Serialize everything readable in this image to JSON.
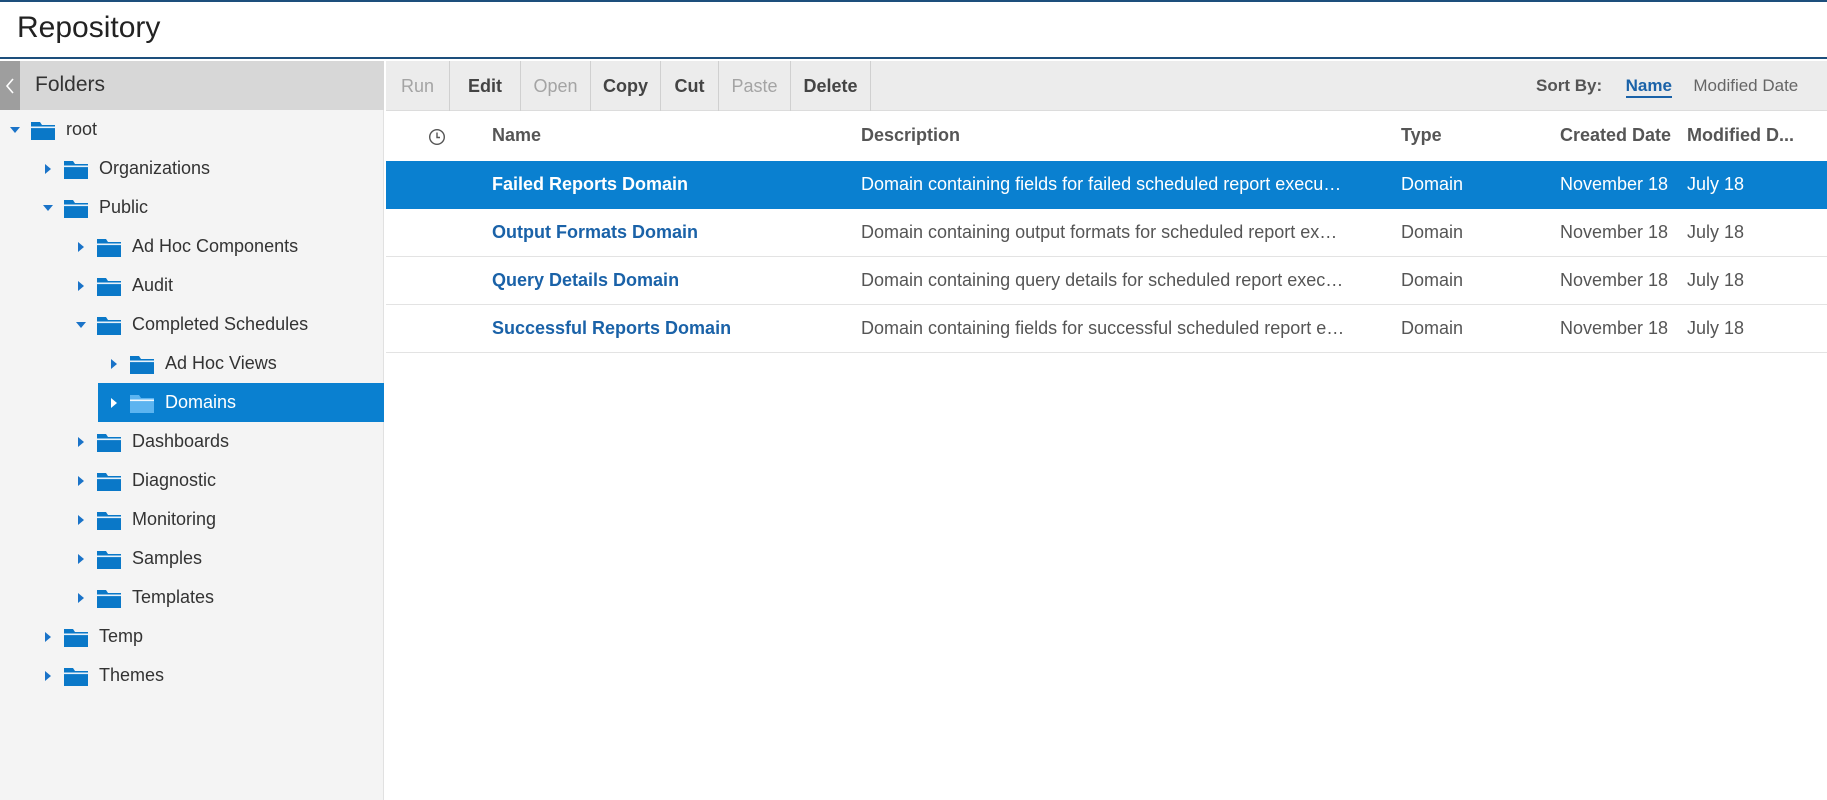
{
  "app": {
    "title": "Repository"
  },
  "folders_panel": {
    "title": "Folders",
    "tree": [
      {
        "label": "root",
        "expanded": true,
        "selected": false
      },
      {
        "label": "Organizations",
        "expanded": false,
        "selected": false
      },
      {
        "label": "Public",
        "expanded": true,
        "selected": false
      },
      {
        "label": "Ad Hoc Components",
        "expanded": false,
        "selected": false
      },
      {
        "label": "Audit",
        "expanded": false,
        "selected": false
      },
      {
        "label": "Completed Schedules",
        "expanded": true,
        "selected": false
      },
      {
        "label": "Ad Hoc Views",
        "expanded": false,
        "selected": false
      },
      {
        "label": "Domains",
        "expanded": false,
        "selected": true
      },
      {
        "label": "Dashboards",
        "expanded": false,
        "selected": false
      },
      {
        "label": "Diagnostic",
        "expanded": false,
        "selected": false
      },
      {
        "label": "Monitoring",
        "expanded": false,
        "selected": false
      },
      {
        "label": "Samples",
        "expanded": false,
        "selected": false
      },
      {
        "label": "Templates",
        "expanded": false,
        "selected": false
      },
      {
        "label": "Temp",
        "expanded": false,
        "selected": false
      },
      {
        "label": "Themes",
        "expanded": false,
        "selected": false
      }
    ]
  },
  "toolbar": {
    "buttons": [
      {
        "label": "Run",
        "enabled": false
      },
      {
        "label": "Edit",
        "enabled": true
      },
      {
        "label": "Open",
        "enabled": false
      },
      {
        "label": "Copy",
        "enabled": true
      },
      {
        "label": "Cut",
        "enabled": true
      },
      {
        "label": "Paste",
        "enabled": false
      },
      {
        "label": "Delete",
        "enabled": true
      }
    ],
    "sort_by_label": "Sort By:",
    "sort_options": [
      "Name",
      "Modified Date"
    ],
    "sort_active": "Name"
  },
  "table": {
    "headers": {
      "name": "Name",
      "description": "Description",
      "type": "Type",
      "created": "Created Date",
      "modified": "Modified D..."
    },
    "rows": [
      {
        "name": "Failed Reports Domain",
        "description": "Domain containing fields for failed scheduled report execu…",
        "type": "Domain",
        "created": "November 18",
        "modified": "July 18",
        "selected": true
      },
      {
        "name": "Output Formats Domain",
        "description": "Domain containing output formats for scheduled report ex…",
        "type": "Domain",
        "created": "November 18",
        "modified": "July 18",
        "selected": false
      },
      {
        "name": "Query Details Domain",
        "description": "Domain containing query details for scheduled report exec…",
        "type": "Domain",
        "created": "November 18",
        "modified": "July 18",
        "selected": false
      },
      {
        "name": "Successful Reports Domain",
        "description": "Domain containing fields for successful scheduled report e…",
        "type": "Domain",
        "created": "November 18",
        "modified": "July 18",
        "selected": false
      }
    ]
  },
  "colors": {
    "accent": "#0a80d0",
    "link": "#1a62a8",
    "folder": "#0a78c8",
    "folder_selected": "#5cb4f0"
  }
}
